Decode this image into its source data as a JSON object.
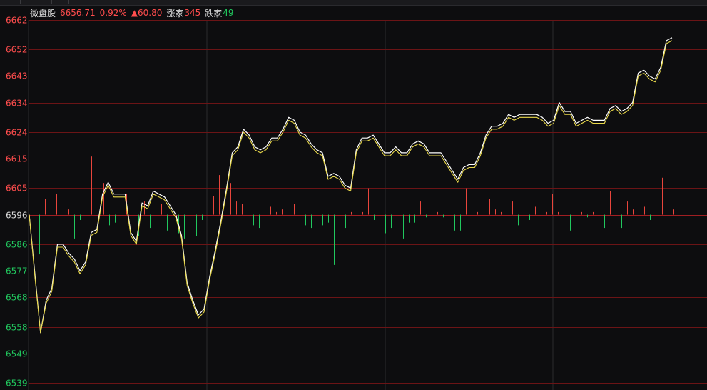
{
  "header": {
    "name": "微盘股",
    "price": "6656.71",
    "pct": "0.92%",
    "change": "▲60.80",
    "up_label": "涨家",
    "up_count": "345",
    "down_label": "跌家",
    "down_count": "49"
  },
  "colors": {
    "background": "#0d0d0f",
    "grid_red": "#6b1416",
    "grid_base": "#a01e22",
    "price_line": "#ffffff",
    "avg_line": "#e8d84a",
    "up": "#ff4d4d",
    "down": "#21c75e",
    "vertical_grid": "#2a2a2e"
  },
  "chart_data": {
    "type": "line",
    "title": "",
    "base_price": 6596,
    "ylim": [
      6539,
      6662
    ],
    "y_ticks": [
      "6662",
      "6652",
      "6643",
      "6634",
      "6624",
      "6615",
      "6605",
      "6596",
      "6586",
      "6577",
      "6568",
      "6558",
      "6549",
      "6539"
    ],
    "series": [
      {
        "kind": "price",
        "values": [
          6596,
          6576,
          6556,
          6567,
          6571,
          6586,
          6586,
          6583,
          6581,
          6577,
          6580,
          6590,
          6591,
          6603,
          6607,
          6603,
          6603,
          6603,
          6590,
          6587,
          6600,
          6599,
          6604,
          6603,
          6602,
          6599,
          6596,
          6589,
          6573,
          6567,
          6562,
          6564,
          6575,
          6584,
          6594,
          6605,
          6617,
          6619,
          6625,
          6623,
          6619,
          6618,
          6619,
          6622,
          6622,
          6625,
          6629,
          6628,
          6624,
          6623,
          6620,
          6618,
          6617,
          6609,
          6610,
          6609,
          6606,
          6605,
          6618,
          6622,
          6622,
          6623,
          6620,
          6617,
          6617,
          6619,
          6617,
          6617,
          6620,
          6621,
          6620,
          6617,
          6617,
          6617,
          6614,
          6611,
          6608,
          6612,
          6613,
          6613,
          6617,
          6623,
          6626,
          6626,
          6627,
          6630,
          6629,
          6630,
          6630,
          6630,
          6630,
          6629,
          6627,
          6628,
          6634,
          6631,
          6631,
          6627,
          6628,
          6629,
          6628,
          6628,
          6628,
          6632,
          6633,
          6631,
          6632,
          6634,
          6644,
          6645,
          6643,
          6642,
          6646,
          6655,
          6656
        ]
      },
      {
        "kind": "average",
        "values": [
          6596,
          6575,
          6556,
          6566,
          6570,
          6585,
          6585,
          6582,
          6580,
          6576,
          6579,
          6589,
          6590,
          6602,
          6606,
          6602,
          6602,
          6602,
          6589,
          6586,
          6599,
          6598,
          6603,
          6602,
          6601,
          6598,
          6595,
          6588,
          6572,
          6566,
          6561,
          6563,
          6574,
          6583,
          6593,
          6604,
          6616,
          6618,
          6624,
          6622,
          6618,
          6617,
          6618,
          6621,
          6621,
          6624,
          6628,
          6627,
          6623,
          6622,
          6619,
          6617,
          6616,
          6608,
          6609,
          6608,
          6605,
          6604,
          6617,
          6621,
          6621,
          6622,
          6619,
          6616,
          6616,
          6618,
          6616,
          6616,
          6619,
          6620,
          6619,
          6616,
          6616,
          6616,
          6613,
          6610,
          6607,
          6611,
          6612,
          6612,
          6616,
          6622,
          6625,
          6625,
          6626,
          6629,
          6628,
          6629,
          6629,
          6629,
          6629,
          6628,
          6626,
          6627,
          6633,
          6630,
          6630,
          6626,
          6627,
          6628,
          6627,
          6627,
          6627,
          6631,
          6632,
          6630,
          6631,
          6633,
          6643,
          6644,
          6642,
          6641,
          6645,
          6654,
          6655
        ]
      }
    ],
    "breadth_bars": [
      {
        "x": 47,
        "v": 2
      },
      {
        "x": 55,
        "v": -15
      },
      {
        "x": 63,
        "v": 6
      },
      {
        "x": 79,
        "v": 8
      },
      {
        "x": 88,
        "v": 1
      },
      {
        "x": 96,
        "v": 2
      },
      {
        "x": 104,
        "v": -9
      },
      {
        "x": 112,
        "v": -2
      },
      {
        "x": 120,
        "v": 1
      },
      {
        "x": 128,
        "v": 22
      },
      {
        "x": 137,
        "v": -3
      },
      {
        "x": 145,
        "v": 12
      },
      {
        "x": 153,
        "v": -4
      },
      {
        "x": 161,
        "v": -3
      },
      {
        "x": 169,
        "v": -4
      },
      {
        "x": 177,
        "v": 8
      },
      {
        "x": 186,
        "v": -4
      },
      {
        "x": 194,
        "v": -8
      },
      {
        "x": 202,
        "v": 5
      },
      {
        "x": 210,
        "v": -5
      },
      {
        "x": 218,
        "v": 9
      },
      {
        "x": 226,
        "v": 4
      },
      {
        "x": 234,
        "v": -6
      },
      {
        "x": 242,
        "v": -5
      },
      {
        "x": 250,
        "v": -7
      },
      {
        "x": 258,
        "v": -9
      },
      {
        "x": 266,
        "v": -6
      },
      {
        "x": 275,
        "v": -8
      },
      {
        "x": 283,
        "v": -2
      },
      {
        "x": 291,
        "v": 11
      },
      {
        "x": 299,
        "v": 7
      },
      {
        "x": 307,
        "v": 15
      },
      {
        "x": 315,
        "v": 7
      },
      {
        "x": 323,
        "v": 12
      },
      {
        "x": 331,
        "v": 5
      },
      {
        "x": 339,
        "v": 4
      },
      {
        "x": 347,
        "v": 2
      },
      {
        "x": 355,
        "v": -4
      },
      {
        "x": 363,
        "v": -5
      },
      {
        "x": 371,
        "v": 7
      },
      {
        "x": 379,
        "v": 3
      },
      {
        "x": 387,
        "v": 1
      },
      {
        "x": 395,
        "v": 2
      },
      {
        "x": 403,
        "v": 1
      },
      {
        "x": 412,
        "v": 4
      },
      {
        "x": 420,
        "v": -2
      },
      {
        "x": 428,
        "v": -4
      },
      {
        "x": 436,
        "v": -5
      },
      {
        "x": 444,
        "v": -7
      },
      {
        "x": 452,
        "v": -4
      },
      {
        "x": 460,
        "v": -3
      },
      {
        "x": 468,
        "v": -19
      },
      {
        "x": 476,
        "v": 5
      },
      {
        "x": 484,
        "v": -5
      },
      {
        "x": 492,
        "v": 1
      },
      {
        "x": 500,
        "v": 2
      },
      {
        "x": 508,
        "v": 1
      },
      {
        "x": 516,
        "v": 10
      },
      {
        "x": 524,
        "v": -2
      },
      {
        "x": 532,
        "v": 4
      },
      {
        "x": 540,
        "v": -7
      },
      {
        "x": 548,
        "v": -5
      },
      {
        "x": 556,
        "v": 4
      },
      {
        "x": 565,
        "v": -9
      },
      {
        "x": 573,
        "v": -3
      },
      {
        "x": 581,
        "v": -3
      },
      {
        "x": 589,
        "v": 5
      },
      {
        "x": 597,
        "v": -1
      },
      {
        "x": 605,
        "v": 1
      },
      {
        "x": 613,
        "v": 1
      },
      {
        "x": 621,
        "v": -1
      },
      {
        "x": 629,
        "v": -5
      },
      {
        "x": 637,
        "v": -6
      },
      {
        "x": 645,
        "v": -6
      },
      {
        "x": 653,
        "v": 10
      },
      {
        "x": 661,
        "v": 1
      },
      {
        "x": 669,
        "v": 1
      },
      {
        "x": 678,
        "v": 10
      },
      {
        "x": 686,
        "v": 6
      },
      {
        "x": 694,
        "v": 2
      },
      {
        "x": 702,
        "v": 1
      },
      {
        "x": 710,
        "v": 1
      },
      {
        "x": 718,
        "v": 5
      },
      {
        "x": 726,
        "v": -4
      },
      {
        "x": 734,
        "v": 6
      },
      {
        "x": 742,
        "v": -2
      },
      {
        "x": 750,
        "v": 3
      },
      {
        "x": 758,
        "v": 1
      },
      {
        "x": 766,
        "v": 1
      },
      {
        "x": 774,
        "v": 8
      },
      {
        "x": 782,
        "v": 1
      },
      {
        "x": 790,
        "v": -1
      },
      {
        "x": 799,
        "v": -6
      },
      {
        "x": 807,
        "v": -5
      },
      {
        "x": 815,
        "v": 1
      },
      {
        "x": 823,
        "v": -1
      },
      {
        "x": 831,
        "v": 1
      },
      {
        "x": 839,
        "v": -6
      },
      {
        "x": 847,
        "v": -5
      },
      {
        "x": 855,
        "v": 9
      },
      {
        "x": 863,
        "v": 3
      },
      {
        "x": 871,
        "v": -5
      },
      {
        "x": 879,
        "v": 5
      },
      {
        "x": 887,
        "v": 2
      },
      {
        "x": 895,
        "v": 14
      },
      {
        "x": 903,
        "v": 3
      },
      {
        "x": 911,
        "v": -2
      },
      {
        "x": 919,
        "v": 1
      },
      {
        "x": 928,
        "v": 14
      },
      {
        "x": 936,
        "v": 2
      },
      {
        "x": 944,
        "v": 2
      }
    ]
  }
}
